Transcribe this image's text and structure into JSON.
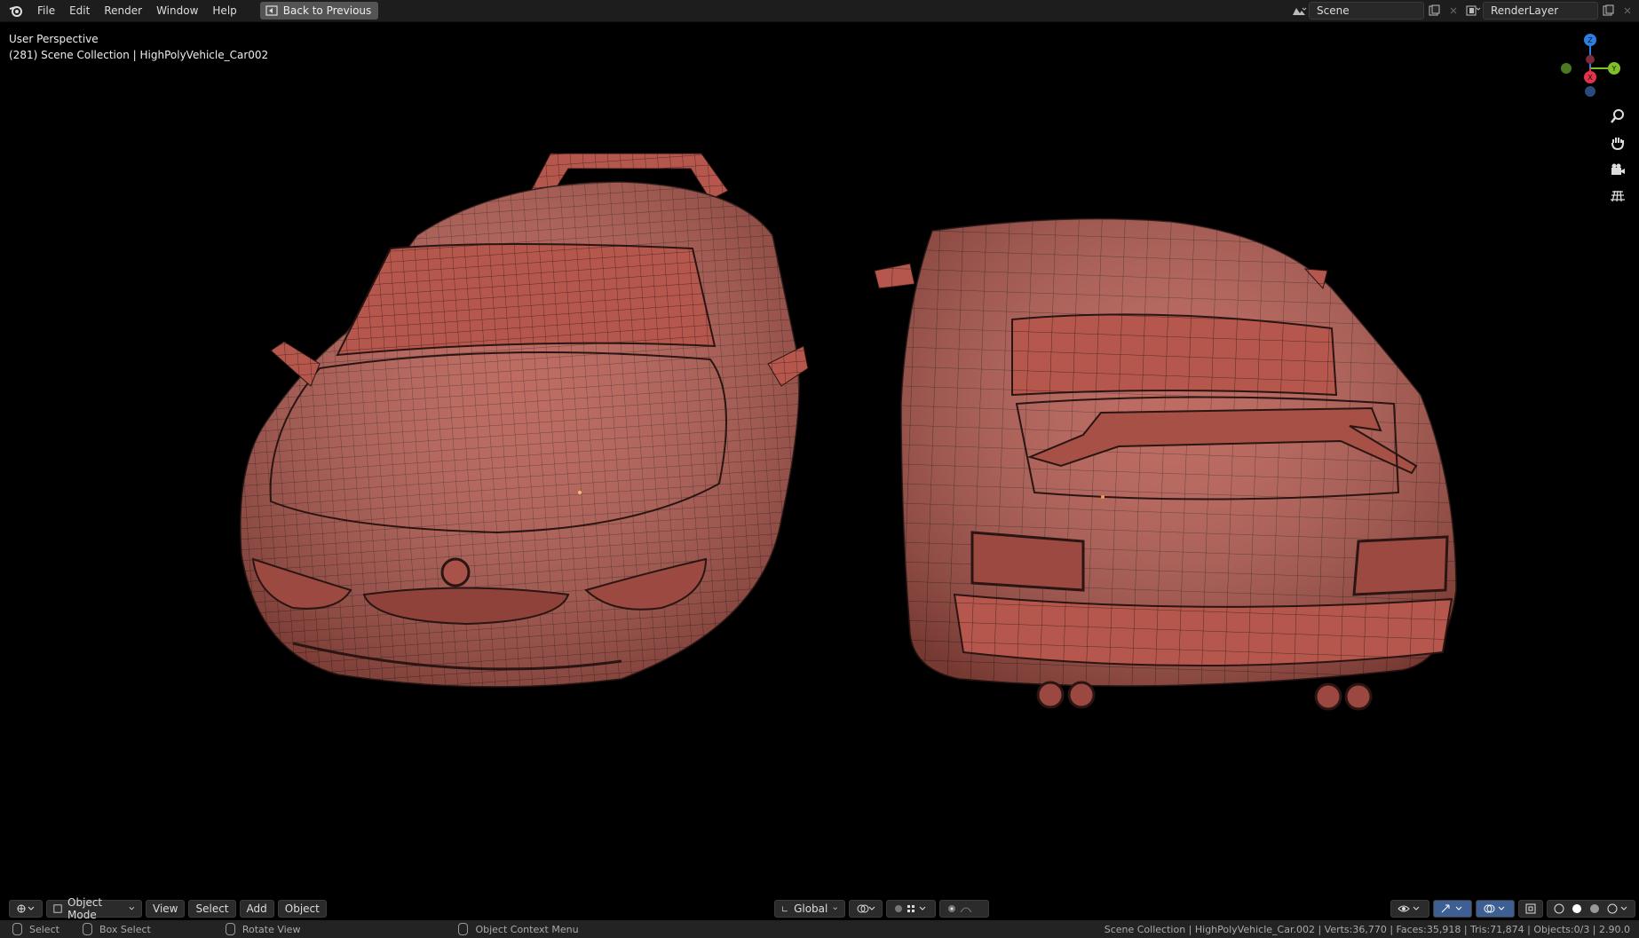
{
  "menu": {
    "items": [
      "File",
      "Edit",
      "Render",
      "Window",
      "Help"
    ],
    "back_label": "Back to Previous"
  },
  "scene": {
    "label": "Scene"
  },
  "renderlayer": {
    "label": "RenderLayer"
  },
  "viewport": {
    "perspective": "User Perspective",
    "collection_info": "(281) Scene Collection | HighPolyVehicle_Car002"
  },
  "gizmo": {
    "z_label": "Z",
    "y_label": "Y",
    "x_label": "X"
  },
  "header": {
    "mode": "Object Mode",
    "view": "View",
    "select": "Select",
    "add": "Add",
    "object": "Object",
    "orientation": "Global"
  },
  "status": {
    "select": "Select",
    "box_select": "Box Select",
    "rotate": "Rotate View",
    "context": "Object Context Menu",
    "stats": "Scene Collection | HighPolyVehicle_Car.002 | Verts:36,770 | Faces:35,918 | Tris:71,874 | Objects:0/3 | 2.90.0"
  },
  "colors": {
    "car": "#b5574c",
    "wire": "#2a1512",
    "axis_x": "#e2334a",
    "axis_y": "#7fbf2a",
    "axis_z": "#2c7fe2"
  }
}
